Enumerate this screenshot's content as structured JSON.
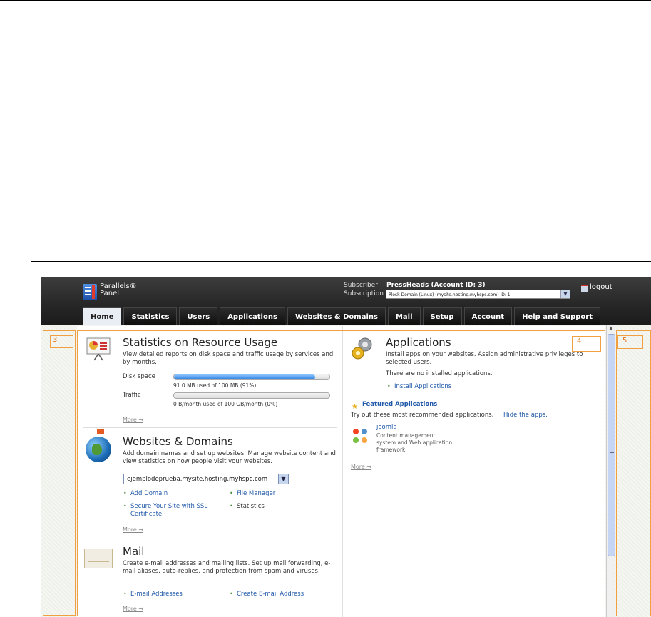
{
  "header": {
    "logo_line1": "Parallels®",
    "logo_line2": "Panel",
    "subscriber_label": "Subscriber",
    "subscriber_value": "PressHeads (Account ID: 3)",
    "subscription_label": "Subscription",
    "subscription_value": "Plesk Domain (Linux) (mysite.hosting.myhspc.com) ID: 1",
    "logout": "logout"
  },
  "tabs": [
    {
      "label": "Home"
    },
    {
      "label": "Statistics"
    },
    {
      "label": "Users"
    },
    {
      "label": "Applications"
    },
    {
      "label": "Websites & Domains"
    },
    {
      "label": "Mail"
    },
    {
      "label": "Setup"
    },
    {
      "label": "Account"
    },
    {
      "label": "Help and Support"
    }
  ],
  "statistics": {
    "title": "Statistics on Resource Usage",
    "description": "View detailed reports on disk space and traffic usage by services and by months.",
    "disk_label": "Disk space",
    "disk_caption": "91.0 MB used of 100 MB (91%)",
    "disk_percent": 91,
    "traffic_label": "Traffic",
    "traffic_caption": "0 B/month used of 100 GB/month (0%)",
    "traffic_percent": 0,
    "more": "More →"
  },
  "websites": {
    "title": "Websites & Domains",
    "description": "Add domain names and set up websites. Manage website content and view statistics on how people visit your websites.",
    "domain_select": "ejemplodeprueba.mysite.hosting.myhspc.com",
    "add_domain": "Add Domain",
    "file_manager": "File Manager",
    "ssl": "Secure Your Site with SSL Certificate",
    "statistics": "Statistics",
    "more": "More →"
  },
  "mail": {
    "title": "Mail",
    "description": "Create e-mail addresses and mailing lists. Set up mail forwarding, e-mail aliases, auto-replies, and protection from spam and viruses.",
    "addresses": "E-mail Addresses",
    "create": "Create E-mail Address",
    "more": "More →"
  },
  "applications": {
    "title": "Applications",
    "description": "Install apps on your websites. Assign administrative privileges to selected users.",
    "none": "There are no installed applications.",
    "install": "Install Applications",
    "featured_title": "Featured Applications",
    "featured_desc": "Try out these most recommended applications.",
    "hide": "Hide the apps.",
    "app_name": "joomla",
    "app_desc": "Content management system and Web application framework",
    "more": "More →"
  },
  "annotations": {
    "box3": "3",
    "box4": "4",
    "box5": "5"
  },
  "colors": {
    "accent_orange": "#f0a040",
    "link_blue": "#1f58a8",
    "progress_blue": "#2a7fe0"
  }
}
